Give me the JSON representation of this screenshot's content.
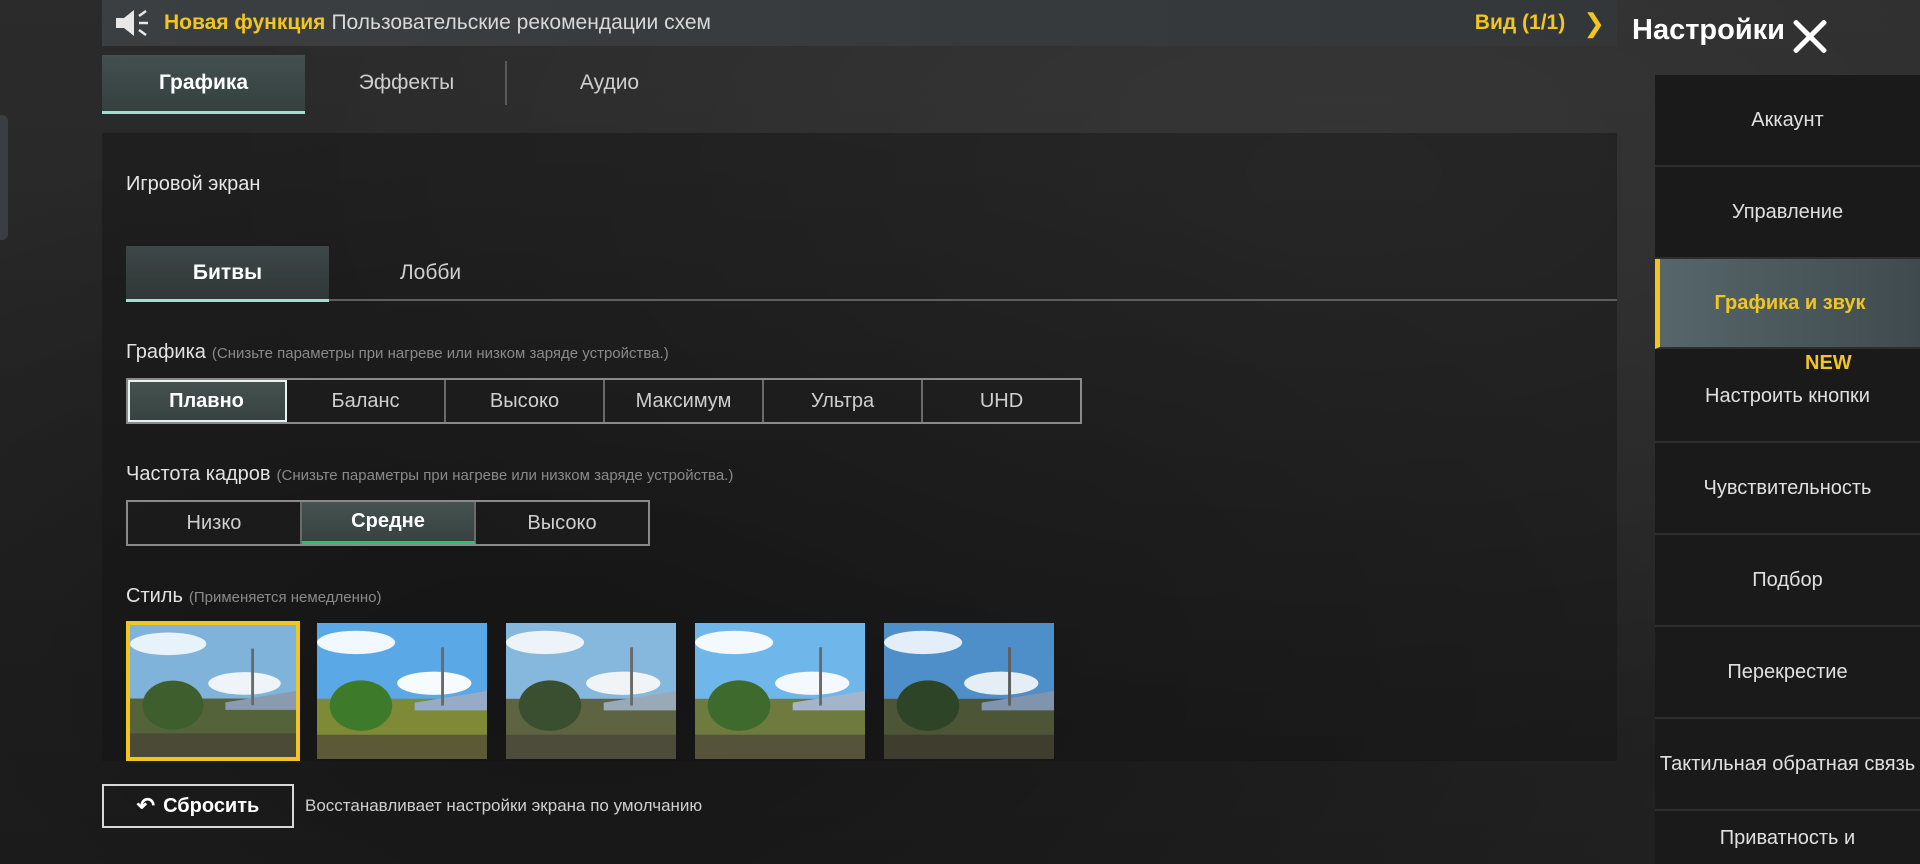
{
  "notice": {
    "highlight": "Новая функция",
    "text": "Пользовательские рекомендации схем",
    "view": "Вид (1/1)"
  },
  "header": {
    "title": "Настройки"
  },
  "tabs": [
    {
      "label": "Графика",
      "active": true
    },
    {
      "label": "Эффекты",
      "active": false
    },
    {
      "label": "Аудио",
      "active": false
    }
  ],
  "panel": {
    "section_title": "Игровой экран",
    "subtabs": [
      {
        "label": "Битвы",
        "active": true
      },
      {
        "label": "Лобби",
        "active": false
      }
    ],
    "graphics": {
      "label": "Графика",
      "hint": "(Снизьте параметры при нагреве или низком заряде устройства.)",
      "options": [
        "Плавно",
        "Баланс",
        "Высоко",
        "Максимум",
        "Ультра",
        "UHD"
      ],
      "selected": "Плавно"
    },
    "framerate": {
      "label": "Частота кадров",
      "hint": "(Снизьте параметры при нагреве или низком заряде устройства.)",
      "options": [
        "Низко",
        "Средне",
        "Высоко"
      ],
      "selected": "Средне"
    },
    "style": {
      "label": "Стиль",
      "hint": "(Применяется немедленно)",
      "selected_index": 0
    }
  },
  "reset": {
    "label": "Сбросить",
    "description": "Восстанавливает настройки экрана по умолчанию"
  },
  "sidebar": {
    "items": [
      {
        "label": "Аккаунт",
        "active": false
      },
      {
        "label": "Управление",
        "active": false
      },
      {
        "label": "Графика и звук",
        "active": true
      },
      {
        "label": "Настроить кнопки",
        "active": false
      },
      {
        "label": "Чувствительность",
        "active": false
      },
      {
        "label": "Подбор",
        "active": false
      },
      {
        "label": "Перекрестие",
        "active": false
      },
      {
        "label": "Тактильная обратная связь",
        "active": false
      },
      {
        "label": "Приватность и",
        "active": false
      }
    ],
    "new_badge": "NEW"
  },
  "colors": {
    "accent": "#f2c522",
    "selected_outline": "#9fe0cf",
    "green_underline": "#2fbf71"
  }
}
